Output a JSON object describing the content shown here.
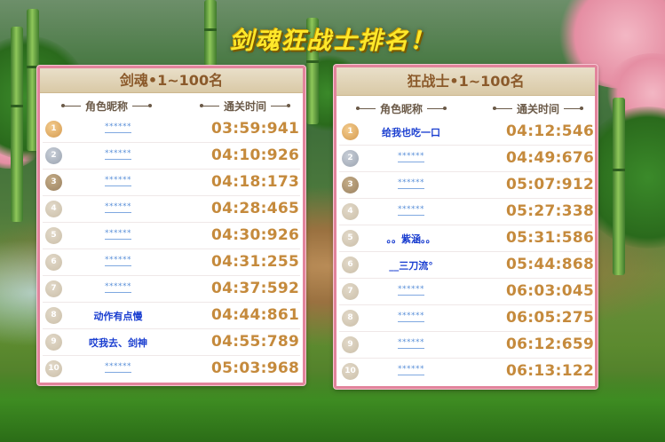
{
  "title": "剑魂狂战士排名！",
  "boards": [
    {
      "header": "剑魂•1~100名",
      "col_name": "角色昵称",
      "col_time": "通关时间",
      "rows": [
        {
          "rank": "1",
          "name": "******",
          "time": "03:59:941",
          "medal": "gold"
        },
        {
          "rank": "2",
          "name": "******",
          "time": "04:10:926",
          "medal": "silver"
        },
        {
          "rank": "3",
          "name": "******",
          "time": "04:18:173",
          "medal": "bronze"
        },
        {
          "rank": "4",
          "name": "******",
          "time": "04:28:465",
          "medal": "plain"
        },
        {
          "rank": "5",
          "name": "******",
          "time": "04:30:926",
          "medal": "plain"
        },
        {
          "rank": "6",
          "name": "******",
          "time": "04:31:255",
          "medal": "plain"
        },
        {
          "rank": "7",
          "name": "******",
          "time": "04:37:592",
          "medal": "plain"
        },
        {
          "rank": "8",
          "name": "动作有点慢",
          "time": "04:44:861",
          "medal": "plain"
        },
        {
          "rank": "9",
          "name": "哎我去、剑神",
          "time": "04:55:789",
          "medal": "plain"
        },
        {
          "rank": "10",
          "name": "******",
          "time": "05:03:968",
          "medal": "plain"
        }
      ]
    },
    {
      "header": "狂战士•1~100名",
      "col_name": "角色昵称",
      "col_time": "通关时间",
      "rows": [
        {
          "rank": "1",
          "name": "给我也吃一口",
          "time": "04:12:546",
          "medal": "gold"
        },
        {
          "rank": "2",
          "name": "******",
          "time": "04:49:676",
          "medal": "silver"
        },
        {
          "rank": "3",
          "name": "******",
          "time": "05:07:912",
          "medal": "bronze"
        },
        {
          "rank": "4",
          "name": "******",
          "time": "05:27:338",
          "medal": "plain"
        },
        {
          "rank": "5",
          "name": "。。紫涵。。",
          "time": "05:31:586",
          "medal": "plain"
        },
        {
          "rank": "6",
          "name": "__三刀流°",
          "time": "05:44:868",
          "medal": "plain"
        },
        {
          "rank": "7",
          "name": "******",
          "time": "06:03:045",
          "medal": "plain"
        },
        {
          "rank": "8",
          "name": "******",
          "time": "06:05:275",
          "medal": "plain"
        },
        {
          "rank": "9",
          "name": "******",
          "time": "06:12:659",
          "medal": "plain"
        },
        {
          "rank": "10",
          "name": "******",
          "time": "06:13:122",
          "medal": "plain"
        }
      ]
    }
  ],
  "colors": {
    "title": "#ffe82a",
    "panel_border": "#e2849c",
    "time": "#c58a3c",
    "name_link": "#1a3ed0",
    "name_masked": "#5a8fd8",
    "header_text": "#8b5a2b"
  }
}
